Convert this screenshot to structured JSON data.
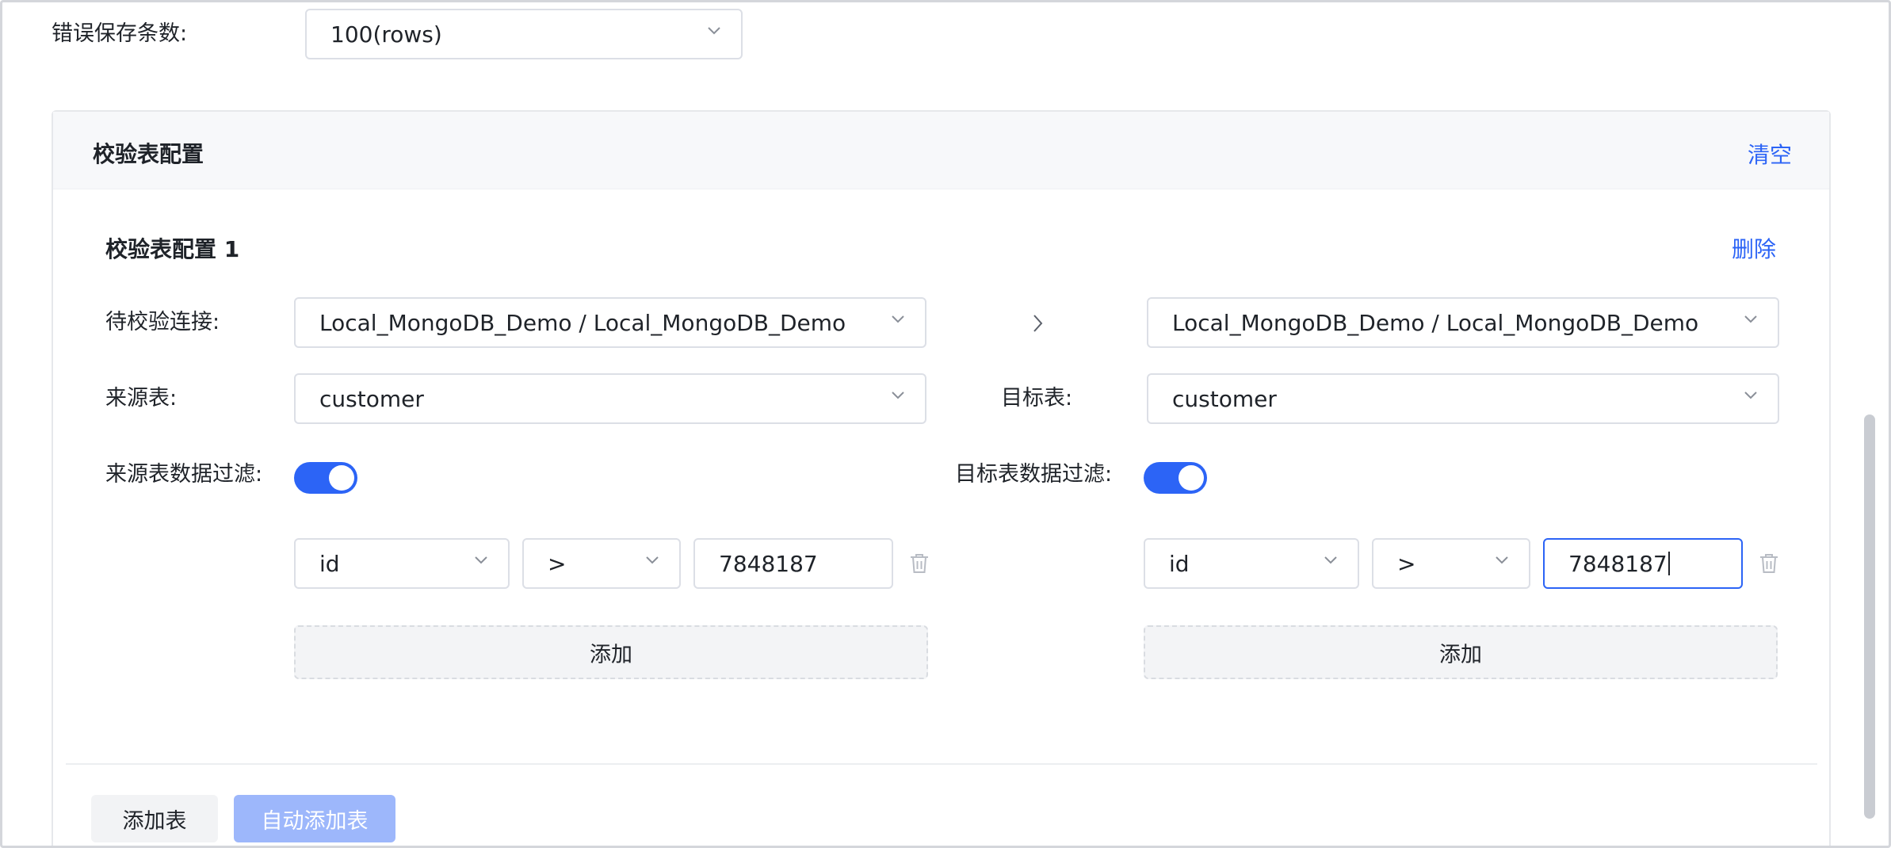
{
  "error_save": {
    "label": "错误保存条数:",
    "value": "100(rows)"
  },
  "section": {
    "title": "校验表配置",
    "clear_label": "清空"
  },
  "config": {
    "title": "校验表配置 1",
    "delete_label": "删除",
    "connection_label": "待校验连接:",
    "source_connection": "Local_MongoDB_Demo / Local_MongoDB_Demo",
    "target_connection": "Local_MongoDB_Demo / Local_MongoDB_Demo",
    "source_table_label": "来源表:",
    "source_table": "customer",
    "target_table_label": "目标表:",
    "target_table": "customer",
    "source_filter_label": "来源表数据过滤:",
    "target_filter_label": "目标表数据过滤:",
    "source_filter_enabled": true,
    "target_filter_enabled": true,
    "source_filter": {
      "field": "id",
      "operator": ">",
      "value": "7848187"
    },
    "target_filter": {
      "field": "id",
      "operator": ">",
      "value": "7848187"
    },
    "add_label": "添加"
  },
  "footer": {
    "add_table_label": "添加表",
    "auto_add_table_label": "自动添加表"
  },
  "colors": {
    "primary": "#2c64f6",
    "primary_disabled": "#9db7fb"
  },
  "icons": {
    "chevron": "chevron-down-icon",
    "arrow": "chevron-right-icon",
    "delete": "trash-icon"
  }
}
